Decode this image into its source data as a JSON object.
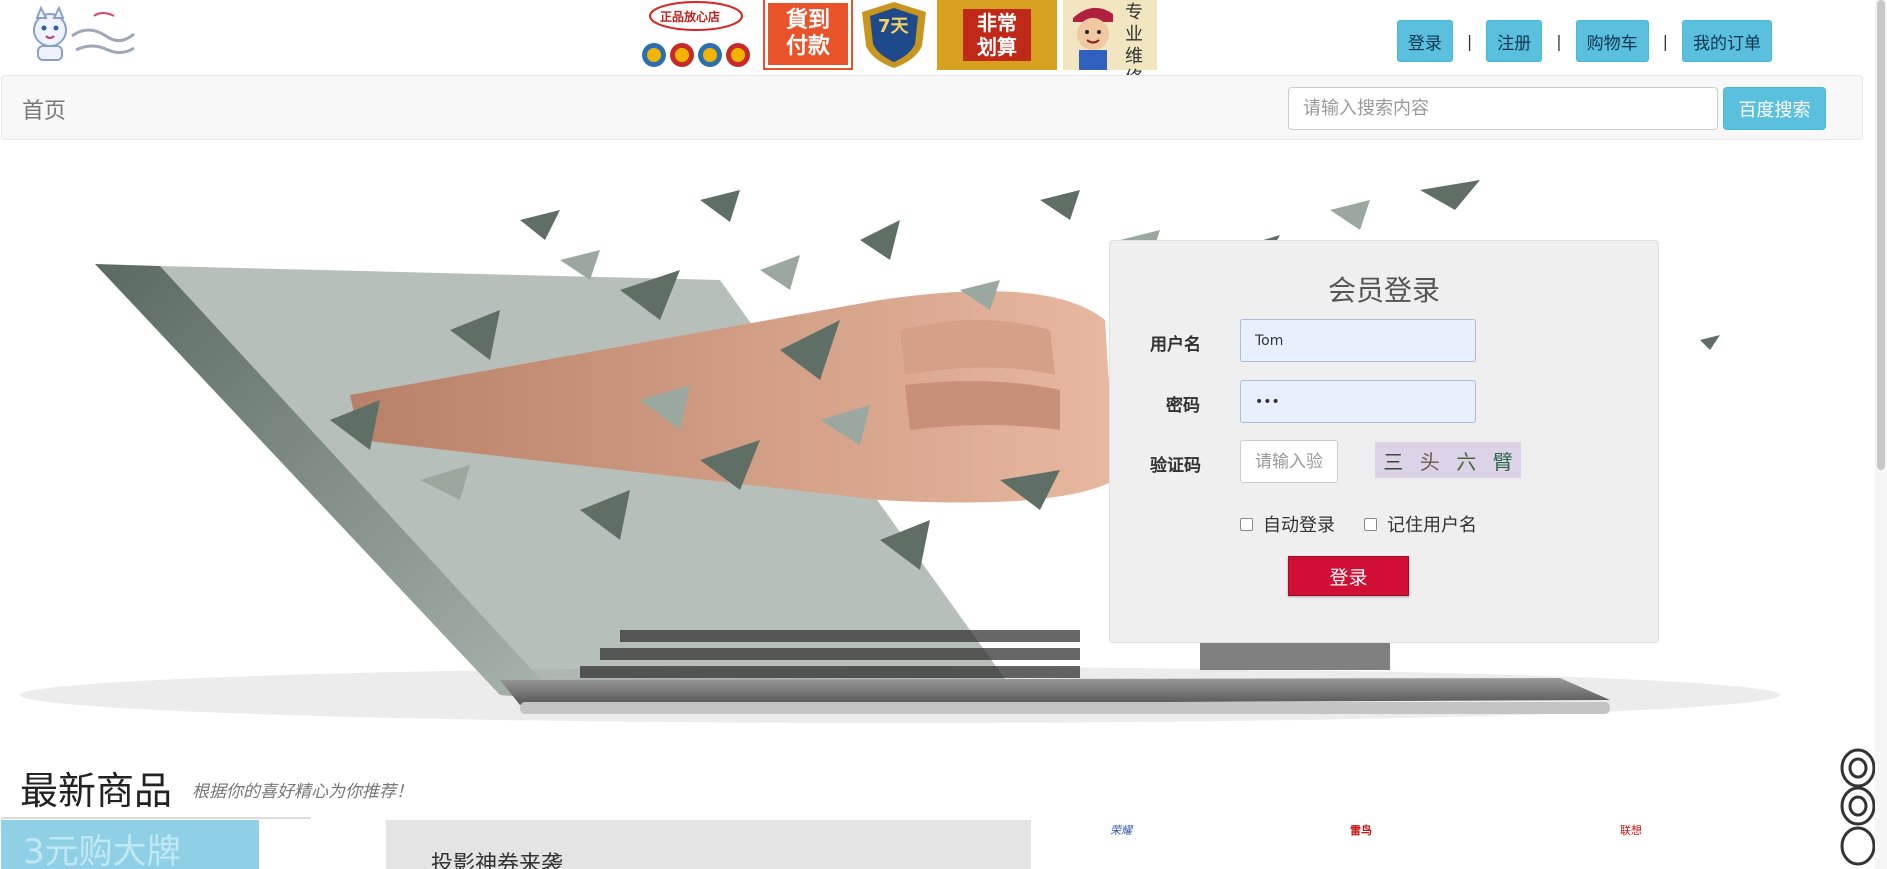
{
  "header": {
    "links": [
      "登录",
      "注册",
      "购物车",
      "我的订单"
    ],
    "separator": "|",
    "promos": {
      "store_badge_text": "正品放心店",
      "cod_text": "貨到付款",
      "seven_day_text": "7天",
      "bargain_text": "非常划算",
      "repair_text": "专业维修"
    }
  },
  "nav": {
    "home": "首页",
    "search_placeholder": "请输入搜索内容",
    "search_button": "百度搜索"
  },
  "login": {
    "title": "会员登录",
    "username_label": "用户名",
    "username_value": "Tom",
    "password_label": "密码",
    "password_value": "•••",
    "captcha_label": "验证码",
    "captcha_placeholder": "请输入验证码",
    "captcha_chars": [
      "三",
      "头",
      "六",
      "臂"
    ],
    "auto_login": "自动登录",
    "remember_user": "记住用户名",
    "submit": "登录"
  },
  "products": {
    "title": "最新商品",
    "subtitle": "根据你的喜好精心为你推荐！",
    "tile1_text": "3元购大牌",
    "tile2_text": "投影神券来袭",
    "brands": [
      "荣耀",
      "雷鸟",
      "联想"
    ]
  },
  "colors": {
    "accent": "#5bc0de",
    "login_button": "#d10f35"
  }
}
